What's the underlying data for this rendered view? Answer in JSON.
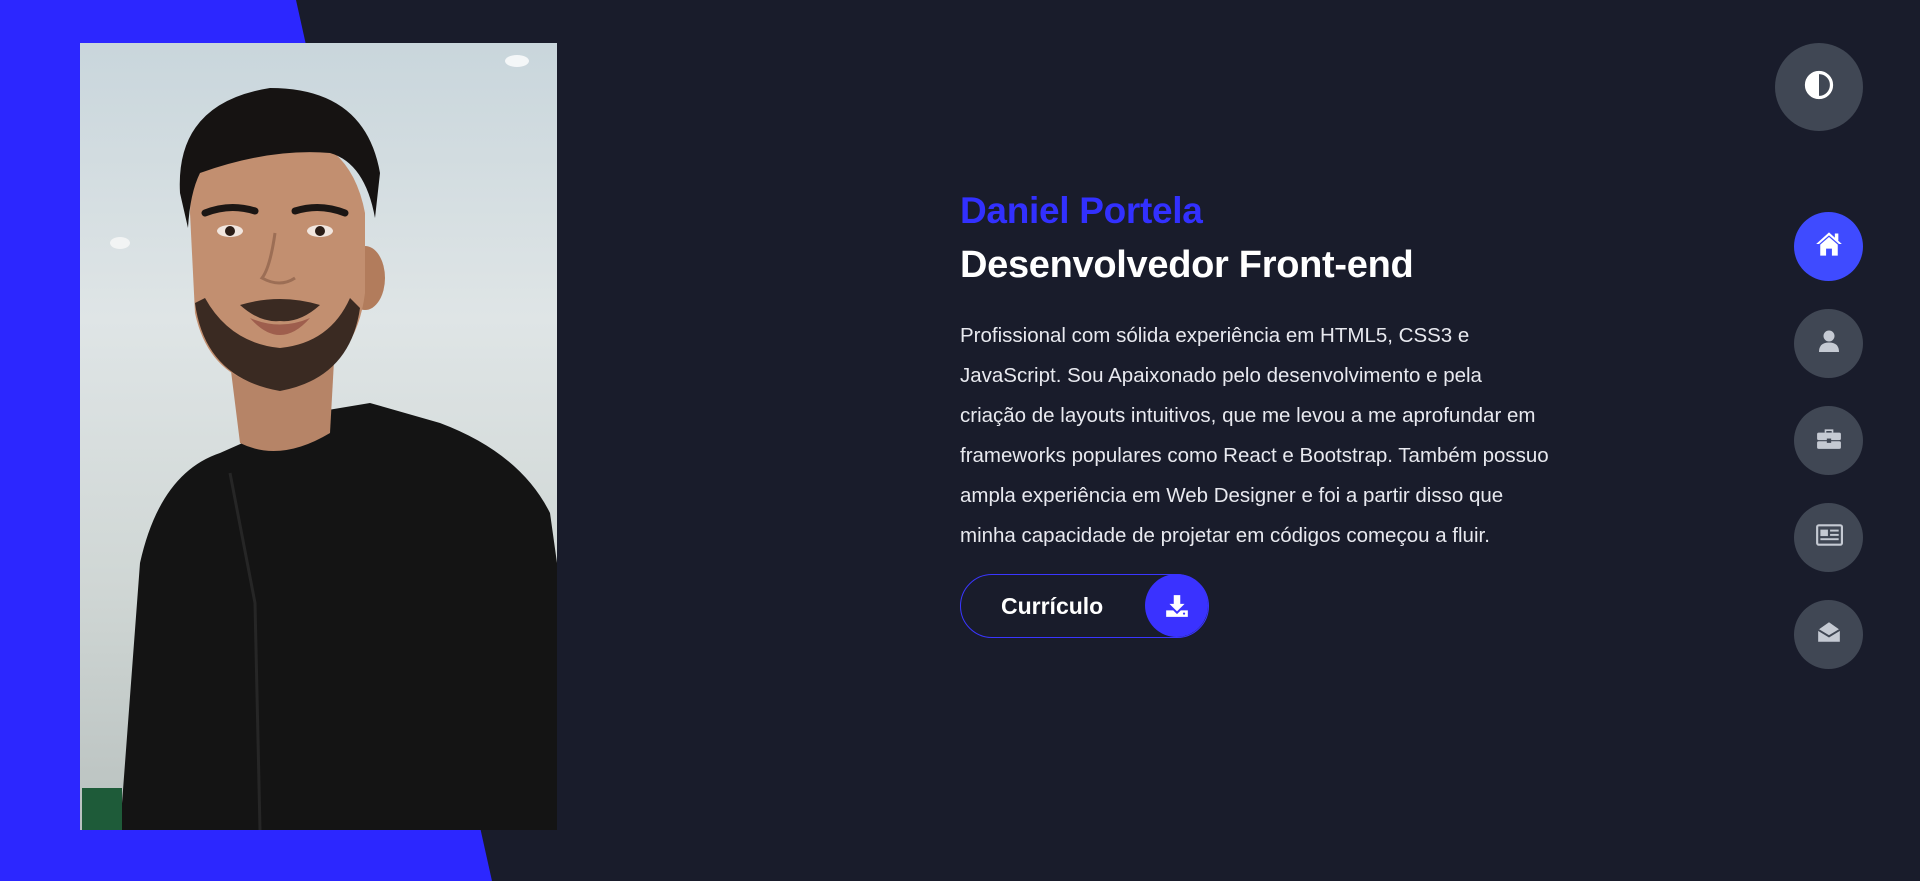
{
  "hero": {
    "name": "Daniel Portela",
    "role": "Desenvolvedor Front-end",
    "bio": "Profissional com sólida experiência em HTML5, CSS3 e JavaScript. Sou Apaixonado pelo desenvolvimento e pela criação de layouts intuitivos, que me levou a me aprofundar em frameworks populares como React e Bootstrap. Também possuo ampla experiência em Web Designer e foi a partir disso que minha capacidade de projetar em códigos começou a fluir.",
    "cv_button_label": "Currículo",
    "cv_button_icon": "download-icon"
  },
  "theme_toggle": {
    "icon": "contrast-icon"
  },
  "nav": {
    "items": [
      {
        "icon": "home-icon",
        "active": true
      },
      {
        "icon": "user-icon",
        "active": false
      },
      {
        "icon": "briefcase-icon",
        "active": false
      },
      {
        "icon": "newspaper-icon",
        "active": false
      },
      {
        "icon": "envelope-open-icon",
        "active": false
      }
    ]
  },
  "colors": {
    "background": "#191c2b",
    "accent": "#2c27ff",
    "nav_button": "#404754",
    "nav_active": "#3f4bff"
  }
}
